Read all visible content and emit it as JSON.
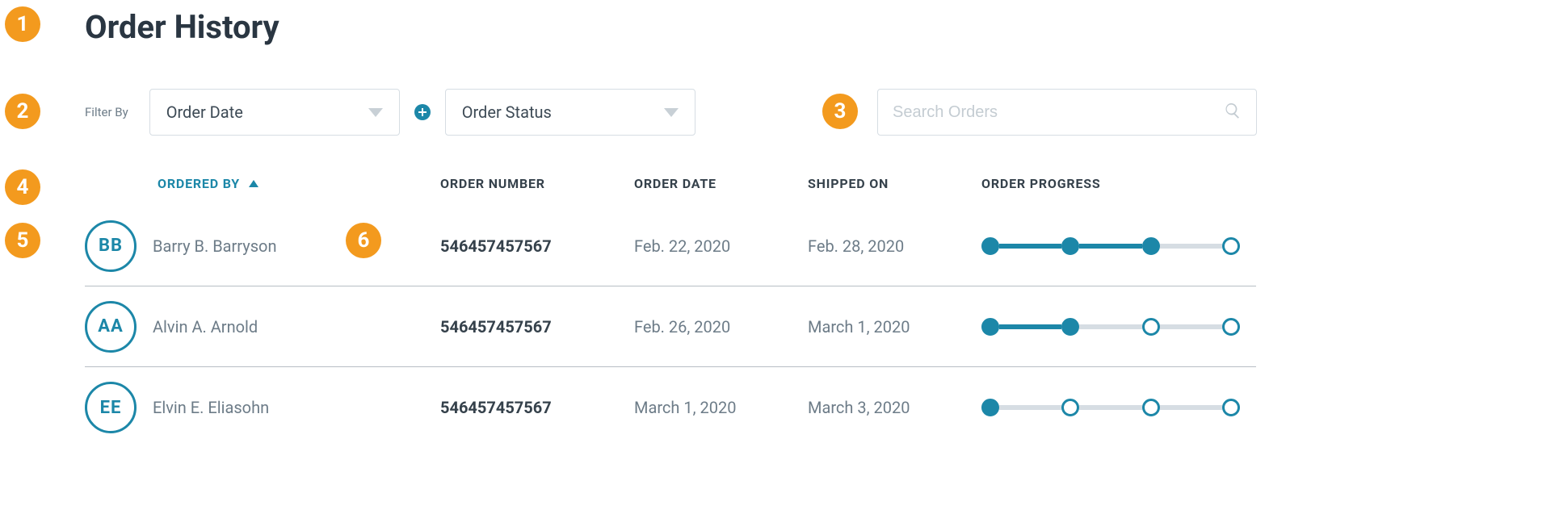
{
  "annotations": [
    "1",
    "2",
    "3",
    "4",
    "5",
    "6"
  ],
  "page_title": "Order History",
  "filters": {
    "label": "Filter By",
    "order_date": "Order Date",
    "order_status": "Order Status"
  },
  "search": {
    "placeholder": "Search Orders"
  },
  "columns": {
    "ordered_by": "ORDERED BY",
    "order_number": "ORDER NUMBER",
    "order_date": "ORDER DATE",
    "shipped_on": "SHIPPED ON",
    "order_progress": "ORDER PROGRESS"
  },
  "rows": [
    {
      "initials": "BB",
      "name": "Barry B. Barryson",
      "number": "546457457567",
      "date": "Feb. 22, 2020",
      "shipped": "Feb. 28, 2020",
      "progress_filled": 3
    },
    {
      "initials": "AA",
      "name": "Alvin A. Arnold",
      "number": "546457457567",
      "date": "Feb. 26, 2020",
      "shipped": "March 1, 2020",
      "progress_filled": 2
    },
    {
      "initials": "EE",
      "name": "Elvin E. Eliasohn",
      "number": "546457457567",
      "date": "March 1, 2020",
      "shipped": "March 3, 2020",
      "progress_filled": 1
    }
  ]
}
